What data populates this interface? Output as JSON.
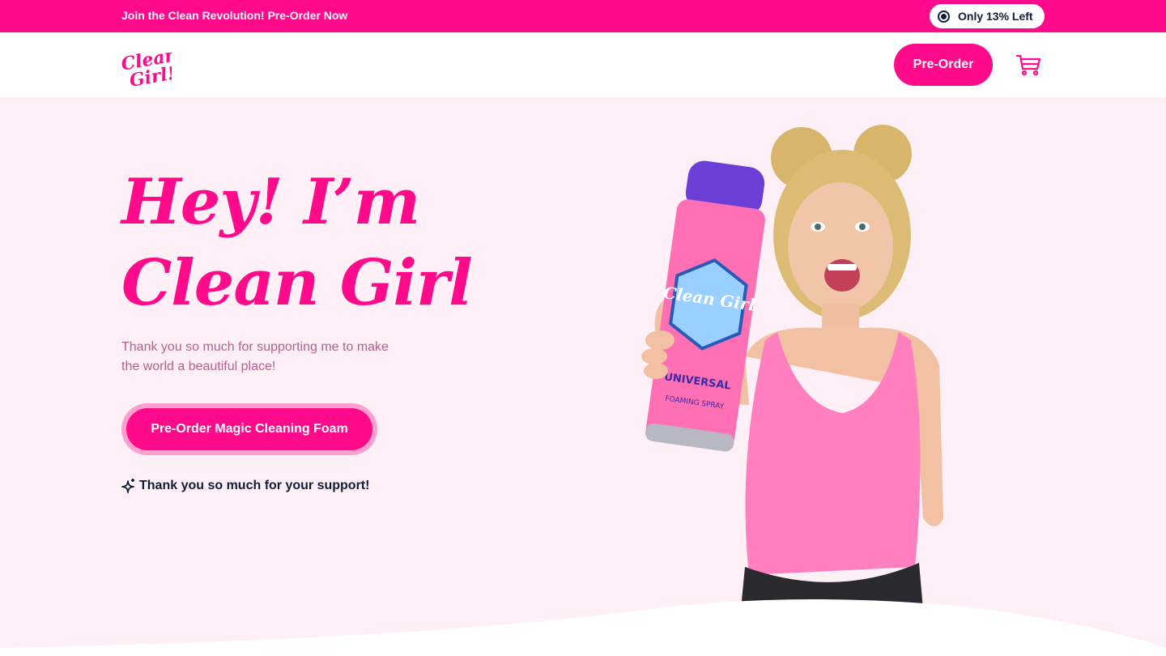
{
  "announcement": {
    "text": "Join the Clean Revolution! Pre-Order Now",
    "stock_label": "Only 13% Left"
  },
  "nav": {
    "logo_text": "Clean Girl!",
    "preorder_label": "Pre-Order",
    "cart_icon": "cart-icon"
  },
  "hero": {
    "title_line1": "Hey! I’m",
    "title_line2": "Clean Girl",
    "subtitle": "Thank you so much for supporting me to make the world a beautiful place!",
    "cta_label": "Pre-Order Magic Cleaning Foam",
    "thanks_text": "Thank you so much for your support!",
    "product_label_brand": "Clean Girl",
    "product_label_type": "UNIVERSAL",
    "product_label_sub": "FOAMING SPRAY"
  },
  "colors": {
    "brand_pink": "#ff0a8a",
    "hero_bg": "#fff0f7",
    "dark_navy": "#0f1d3a"
  }
}
